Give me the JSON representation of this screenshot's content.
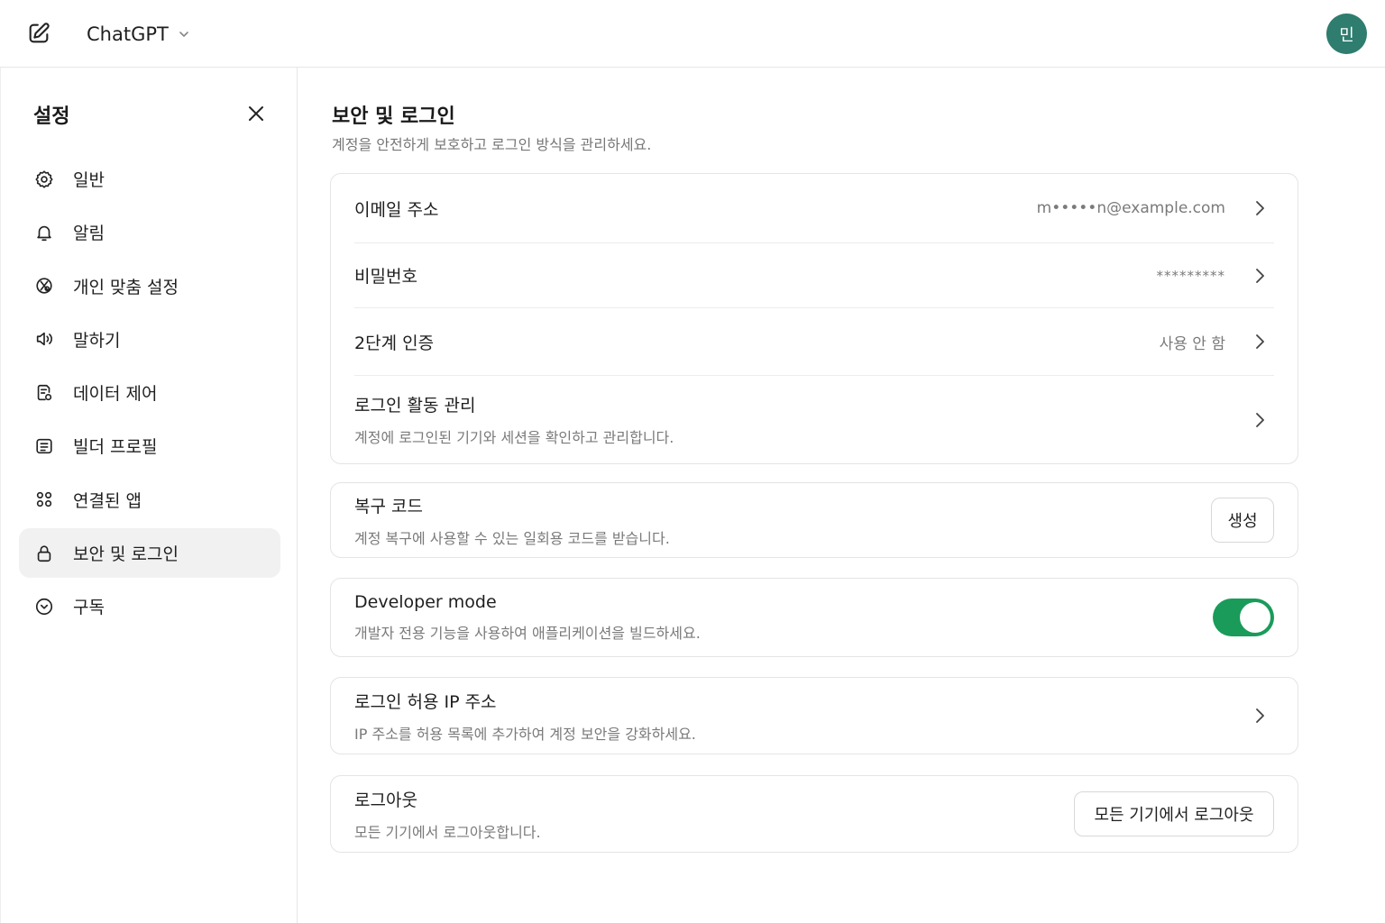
{
  "header": {
    "model_name": "ChatGPT",
    "avatar_initial": "민"
  },
  "sidebar": {
    "title": "설정",
    "items": [
      {
        "label": "일반",
        "icon": "gear-icon",
        "active": false
      },
      {
        "label": "알림",
        "icon": "bell-icon",
        "active": false
      },
      {
        "label": "개인 맞춤 설정",
        "icon": "personalize-icon",
        "active": false
      },
      {
        "label": "말하기",
        "icon": "speaker-icon",
        "active": false
      },
      {
        "label": "데이터 제어",
        "icon": "data-control-icon",
        "active": false
      },
      {
        "label": "빌더 프로필",
        "icon": "builder-profile-icon",
        "active": false
      },
      {
        "label": "연결된 앱",
        "icon": "apps-grid-icon",
        "active": false
      },
      {
        "label": "보안 및 로그인",
        "icon": "lock-icon",
        "active": true
      },
      {
        "label": "구독",
        "icon": "subscription-icon",
        "active": false
      }
    ]
  },
  "main": {
    "title": "보안 및 로그인",
    "subtitle": "계정을 안전하게 보호하고 로그인 방식을 관리하세요.",
    "account_card": {
      "email": {
        "label": "이메일 주소",
        "value": "m•••••n@example.com"
      },
      "password": {
        "label": "비밀번호",
        "value": "*********"
      },
      "two_factor": {
        "label": "2단계 인증",
        "value": "사용 안 함"
      },
      "login_activity": {
        "label": "로그인 활동 관리",
        "desc": "계정에 로그인된 기기와 세션을 확인하고 관리합니다."
      }
    },
    "recovery": {
      "label": "복구 코드",
      "desc": "계정 복구에 사용할 수 있는 일회용 코드를 받습니다.",
      "button": "생성"
    },
    "developer": {
      "label": "Developer mode",
      "desc": "개발자 전용 기능을 사용하여 애플리케이션을 빌드하세요.",
      "enabled": true,
      "toggle_color": "#1a9b5a"
    },
    "ip_allowlist": {
      "label": "로그인 허용 IP 주소",
      "desc": "IP 주소를 허용 목록에 추가하여 계정 보안을 강화하세요."
    },
    "logout": {
      "label": "로그아웃",
      "desc": "모든 기기에서 로그아웃합니다.",
      "button": "모든 기기에서 로그아웃"
    }
  },
  "colors": {
    "avatar": "#2e7d6f",
    "toggle_on": "#1a9b5a",
    "active_nav_bg": "#f1f1f1"
  }
}
